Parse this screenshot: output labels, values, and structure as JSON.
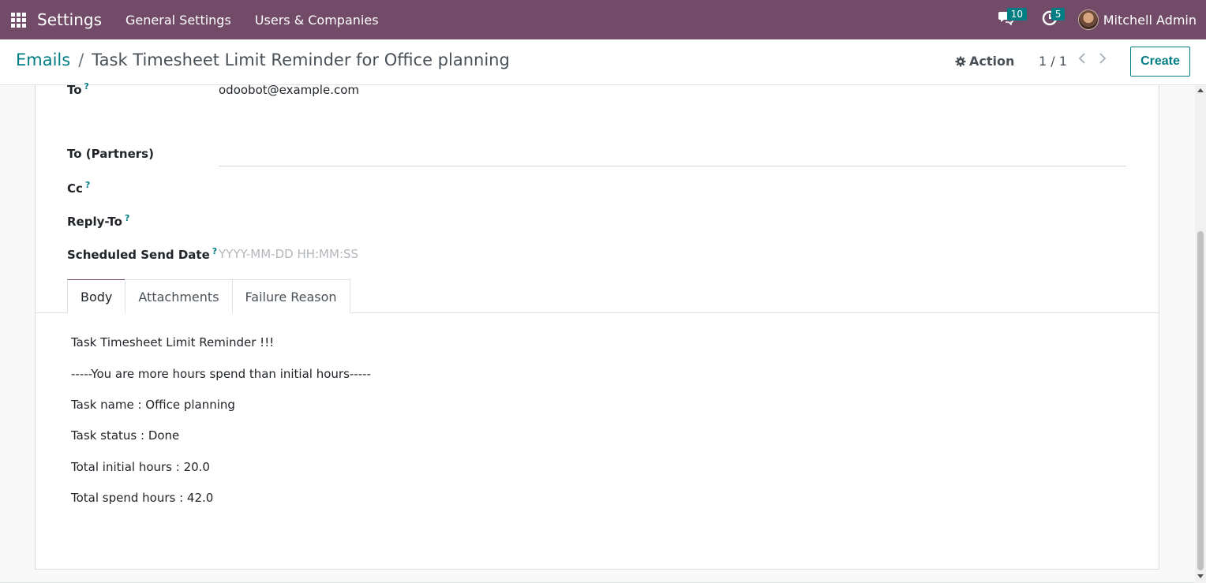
{
  "navbar": {
    "app_title": "Settings",
    "menu": [
      "General Settings",
      "Users & Companies"
    ],
    "messages_count": "10",
    "activities_count": "5",
    "user_name": "Mitchell Admin"
  },
  "breadcrumb": {
    "parent": "Emails",
    "separator": "/",
    "current": "Task Timesheet Limit Reminder for Office planning"
  },
  "control": {
    "action_label": "Action",
    "pager": "1 / 1",
    "create_label": "Create"
  },
  "form": {
    "to_label": "To",
    "to_value": "odoobot@example.com",
    "to_partners_label": "To (Partners)",
    "cc_label": "Cc",
    "reply_to_label": "Reply-To",
    "scheduled_label": "Scheduled Send Date",
    "scheduled_placeholder": "YYYY-MM-DD HH:MM:SS",
    "help_mark": "?"
  },
  "tabs": [
    "Body",
    "Attachments",
    "Failure Reason"
  ],
  "body": {
    "lines": [
      "Task Timesheet Limit Reminder !!!",
      "-----You are more hours spend than initial hours-----",
      "Task name : Office planning",
      "Task status : Done",
      "Total initial hours : 20.0",
      "Total spend hours : 42.0"
    ]
  },
  "colors": {
    "brand": "#714b67",
    "accent": "#017e84"
  }
}
